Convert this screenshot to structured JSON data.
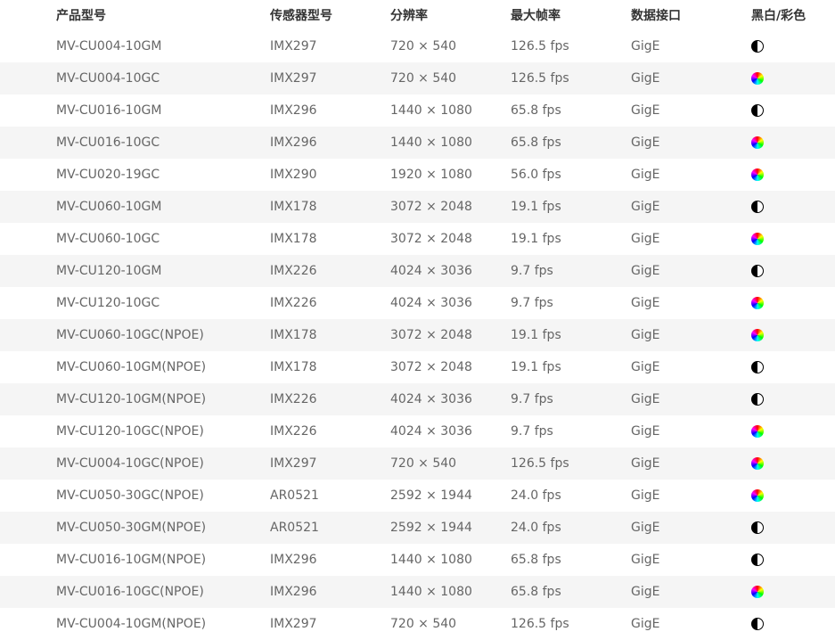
{
  "headers": {
    "model": "产品型号",
    "sensor": "传感器型号",
    "resolution": "分辨率",
    "fps": "最大帧率",
    "interface": "数据接口",
    "type": "黑白/彩色"
  },
  "rows": [
    {
      "model": "MV-CU004-10GM",
      "sensor": "IMX297",
      "resolution": "720 × 540",
      "fps": "126.5 fps",
      "interface": "GigE",
      "type_icon": "mono-icon"
    },
    {
      "model": "MV-CU004-10GC",
      "sensor": "IMX297",
      "resolution": "720 × 540",
      "fps": "126.5 fps",
      "interface": "GigE",
      "type_icon": "color-wheel-icon"
    },
    {
      "model": "MV-CU016-10GM",
      "sensor": "IMX296",
      "resolution": "1440 × 1080",
      "fps": "65.8 fps",
      "interface": "GigE",
      "type_icon": "mono-icon"
    },
    {
      "model": "MV-CU016-10GC",
      "sensor": "IMX296",
      "resolution": "1440 × 1080",
      "fps": "65.8 fps",
      "interface": "GigE",
      "type_icon": "color-wheel-icon"
    },
    {
      "model": "MV-CU020-19GC",
      "sensor": "IMX290",
      "resolution": "1920 × 1080",
      "fps": "56.0 fps",
      "interface": "GigE",
      "type_icon": "color-wheel-icon"
    },
    {
      "model": "MV-CU060-10GM",
      "sensor": "IMX178",
      "resolution": "3072 × 2048",
      "fps": "19.1 fps",
      "interface": "GigE",
      "type_icon": "mono-icon"
    },
    {
      "model": "MV-CU060-10GC",
      "sensor": "IMX178",
      "resolution": "3072 × 2048",
      "fps": "19.1 fps",
      "interface": "GigE",
      "type_icon": "color-wheel-icon"
    },
    {
      "model": "MV-CU120-10GM",
      "sensor": "IMX226",
      "resolution": "4024 × 3036",
      "fps": "9.7 fps",
      "interface": "GigE",
      "type_icon": "mono-icon"
    },
    {
      "model": "MV-CU120-10GC",
      "sensor": "IMX226",
      "resolution": "4024 × 3036",
      "fps": "9.7 fps",
      "interface": "GigE",
      "type_icon": "color-wheel-icon"
    },
    {
      "model": "MV-CU060-10GC(NPOE)",
      "sensor": "IMX178",
      "resolution": "3072 × 2048",
      "fps": "19.1 fps",
      "interface": "GigE",
      "type_icon": "color-wheel-icon"
    },
    {
      "model": "MV-CU060-10GM(NPOE)",
      "sensor": "IMX178",
      "resolution": "3072 × 2048",
      "fps": "19.1 fps",
      "interface": "GigE",
      "type_icon": "mono-icon"
    },
    {
      "model": "MV-CU120-10GM(NPOE)",
      "sensor": "IMX226",
      "resolution": "4024 × 3036",
      "fps": "9.7 fps",
      "interface": "GigE",
      "type_icon": "mono-icon"
    },
    {
      "model": "MV-CU120-10GC(NPOE)",
      "sensor": "IMX226",
      "resolution": "4024 × 3036",
      "fps": "9.7 fps",
      "interface": "GigE",
      "type_icon": "color-wheel-icon"
    },
    {
      "model": "MV-CU004-10GC(NPOE)",
      "sensor": "IMX297",
      "resolution": "720 × 540",
      "fps": "126.5 fps",
      "interface": "GigE",
      "type_icon": "color-wheel-icon"
    },
    {
      "model": "MV-CU050-30GC(NPOE)",
      "sensor": "AR0521",
      "resolution": "2592 × 1944",
      "fps": "24.0 fps",
      "interface": "GigE",
      "type_icon": "color-wheel-icon"
    },
    {
      "model": "MV-CU050-30GM(NPOE)",
      "sensor": "AR0521",
      "resolution": "2592 × 1944",
      "fps": "24.0 fps",
      "interface": "GigE",
      "type_icon": "mono-icon"
    },
    {
      "model": "MV-CU016-10GM(NPOE)",
      "sensor": "IMX296",
      "resolution": "1440 × 1080",
      "fps": "65.8 fps",
      "interface": "GigE",
      "type_icon": "mono-icon"
    },
    {
      "model": "MV-CU016-10GC(NPOE)",
      "sensor": "IMX296",
      "resolution": "1440 × 1080",
      "fps": "65.8 fps",
      "interface": "GigE",
      "type_icon": "color-wheel-icon"
    },
    {
      "model": "MV-CU004-10GM(NPOE)",
      "sensor": "IMX297",
      "resolution": "720 × 540",
      "fps": "126.5 fps",
      "interface": "GigE",
      "type_icon": "mono-icon"
    }
  ],
  "colors": {
    "header_text": "#333333",
    "cell_text": "#666666",
    "row_alt_bg": "#f5f5f5"
  }
}
